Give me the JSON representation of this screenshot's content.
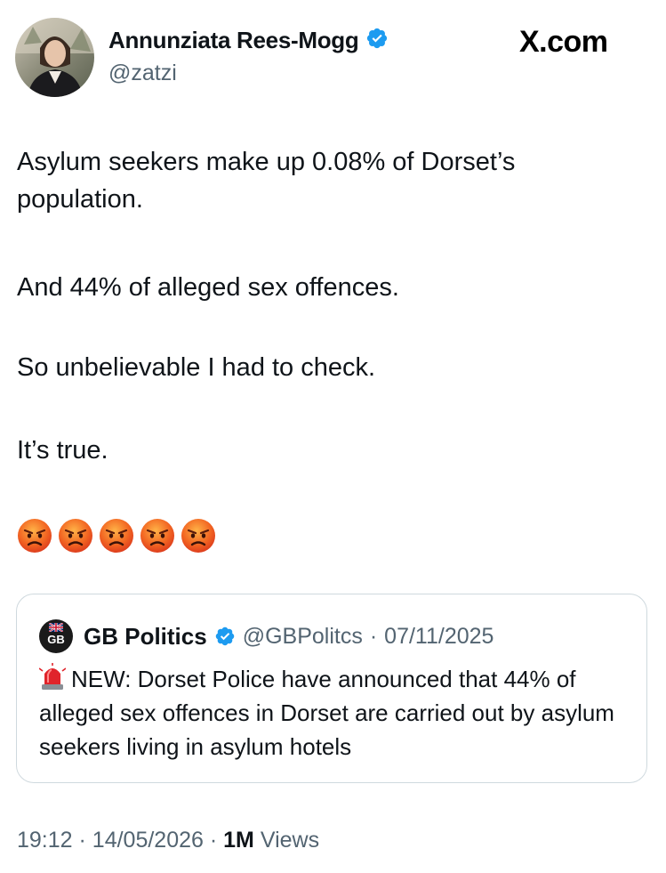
{
  "site": {
    "logo_text": "X.com"
  },
  "author": {
    "name": "Annunziata Rees-Mogg",
    "handle": "@zatzi",
    "verified_color": "#1d9bf0"
  },
  "tweet": {
    "paragraphs": [
      "Asylum seekers make up 0.08% of Dorset’s\npopulation.",
      "And 44% of alleged sex offences.",
      "So unbelievable I had to check.",
      "It’s true."
    ],
    "emojis": [
      "pouting-face-emoji",
      "pouting-face-emoji",
      "pouting-face-emoji",
      "pouting-face-emoji",
      "pouting-face-emoji"
    ]
  },
  "quoted_tweet": {
    "avatar_text": "GB",
    "name": "GB Politics",
    "handle": "@GBPolitcs",
    "separator": "·",
    "date": "07/11/2025",
    "text": "NEW: Dorset Police have announced that 44% of alleged sex offences in Dorset are carried out by asylum seekers living in asylum hotels"
  },
  "footer": {
    "time": "19:12",
    "separator": "·",
    "date": "14/05/2026",
    "views_count": "1M",
    "views_label": "Views"
  }
}
